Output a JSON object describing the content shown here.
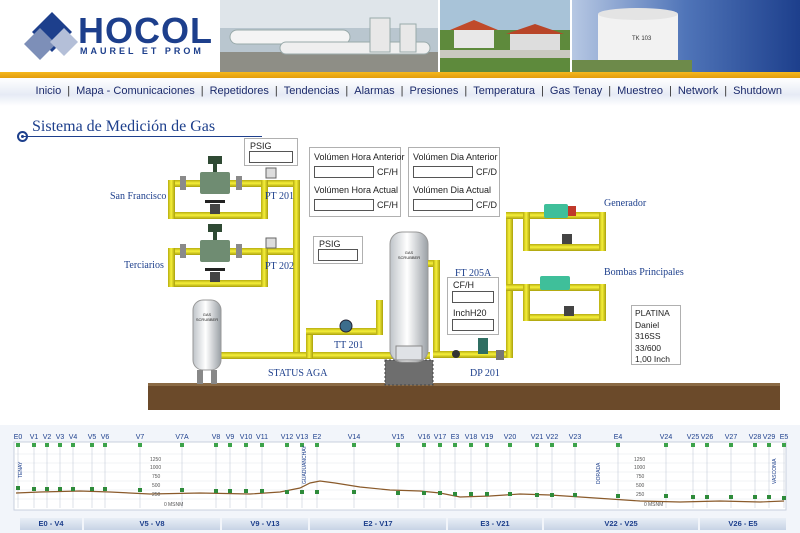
{
  "header": {
    "logo_word": "HOCOL",
    "logo_sub": "MAUREL ET PROM",
    "colors": {
      "brand_blue": "#1d3f8c",
      "gold": "#f4b81e",
      "pipe_yellow": "#f2ea2e"
    }
  },
  "nav": {
    "items": [
      "Inicio",
      "Mapa - Comunicaciones",
      "Repetidores",
      "Tendencias",
      "Alarmas",
      "Presiones",
      "Temperatura",
      "Gas Tenay",
      "Muestreo",
      "Network",
      "Shutdown"
    ],
    "separator": "|"
  },
  "page": {
    "title": "Sistema de Medición de Gas"
  },
  "diagram": {
    "labels": {
      "san_francisco": "San Francisco",
      "terciarios": "Terciarios",
      "pt201": "PT 201",
      "pt202": "PT 202",
      "tt201": "TT 201",
      "status_aga": "STATUS AGA",
      "ft205a": "FT 205A",
      "dp201": "DP 201",
      "generador": "Generador",
      "bombas": "Bombas Principales",
      "gas_scrubber": "GAS SCRUBBER"
    },
    "psig1": {
      "label": "PSIG",
      "value": ""
    },
    "psig2": {
      "label": "PSIG",
      "value": ""
    },
    "vol_hora_anterior": {
      "label": "Volúmen Hora Anterior",
      "unit": "CF/H",
      "value": ""
    },
    "vol_hora_actual": {
      "label": "Volúmen Hora Actual",
      "unit": "CF/H",
      "value": ""
    },
    "vol_dia_anterior": {
      "label": "Volúmen Dia Anterior",
      "unit": "CF/D",
      "value": ""
    },
    "vol_dia_actual": {
      "label": "Volúmen Dia Actual",
      "unit": "CF/D",
      "value": ""
    },
    "ft_cfh": {
      "label": "CF/H",
      "value": ""
    },
    "ft_inch": {
      "label": "InchH20",
      "value": ""
    },
    "platina": {
      "line1": "PLATINA",
      "line2": "Daniel",
      "line3": "316SS",
      "line4": "33/600",
      "line5": "1,00 Inch"
    }
  },
  "profile": {
    "stations": [
      "E0",
      "V1",
      "V2",
      "V3",
      "V4",
      "V5",
      "V6",
      "V7",
      "V7A",
      "V8",
      "V9",
      "V10",
      "V11",
      "V12",
      "V13",
      "E2",
      "V14",
      "V15",
      "V16",
      "V17",
      "E3",
      "V18",
      "V19",
      "V20",
      "V21",
      "V22",
      "V23",
      "E4",
      "V24",
      "V25",
      "V26",
      "V27",
      "V28",
      "V29",
      "E5"
    ],
    "scale_left": [
      "1250",
      "1000",
      "750",
      "500",
      "250",
      "0",
      "MSNM"
    ],
    "scale_right": [
      "1250",
      "1000",
      "750",
      "500",
      "250",
      "0",
      "MSNM"
    ],
    "place_labels": {
      "tenay": "TENAY",
      "guaduas": "GUADUANCHAY",
      "dorada": "DORADA",
      "vasconia": "VASCONIA"
    },
    "segments": [
      "E0 - V4",
      "V5 - V8",
      "V9 - V13",
      "E2 - V17",
      "E3 - V21",
      "V22 - V25",
      "V26 - E5"
    ]
  }
}
